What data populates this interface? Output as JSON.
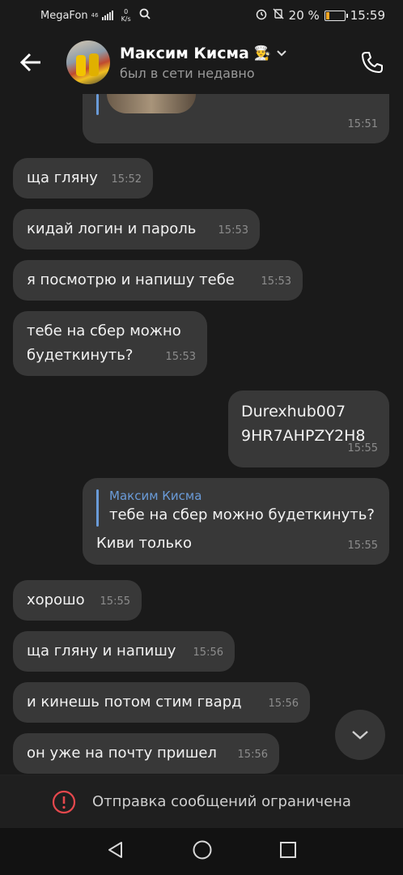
{
  "status_bar": {
    "carrier": "MegaFon",
    "network": "46",
    "speed_value": "0",
    "speed_unit": "K/s",
    "battery": "20 %",
    "battery_level": 0.2,
    "time": "15:59"
  },
  "header": {
    "name": "Максим Кисма",
    "emoji": "👨‍🍳",
    "last_seen": "был в сети недавно"
  },
  "messages": [
    {
      "text": "ща гляну",
      "time": "15:52"
    },
    {
      "text": "кидай логин и пароль",
      "time": "15:53"
    },
    {
      "text": "я посмотрю и напишу тебе",
      "time": "15:53"
    },
    {
      "text_line1": "тебе на сбер можно",
      "text_line2": "будеткинуть?",
      "time": "15:53"
    },
    {
      "text_line1": "Durexhub007",
      "text_line2": "9HR7AHPZY2H8",
      "time": "15:55"
    },
    {
      "reply_name": "Максим Кисма",
      "reply_text": "тебе на сбер можно будеткинуть?",
      "text": "Киви только",
      "time": "15:55"
    },
    {
      "text": "хорошо",
      "time": "15:55"
    },
    {
      "text": "ща гляну и напишу",
      "time": "15:56"
    },
    {
      "text": "и кинешь потом стим гвард",
      "time": "15:56"
    },
    {
      "text": "он уже на почту пришел",
      "time": "15:56"
    }
  ],
  "top_partial_time": "15:51",
  "restricted_text": "Отправка сообщений ограничена",
  "colors": {
    "background": "#1a1a1a",
    "bubble": "#383838",
    "accent": "#6a9bd8",
    "warning": "#e5484d"
  }
}
